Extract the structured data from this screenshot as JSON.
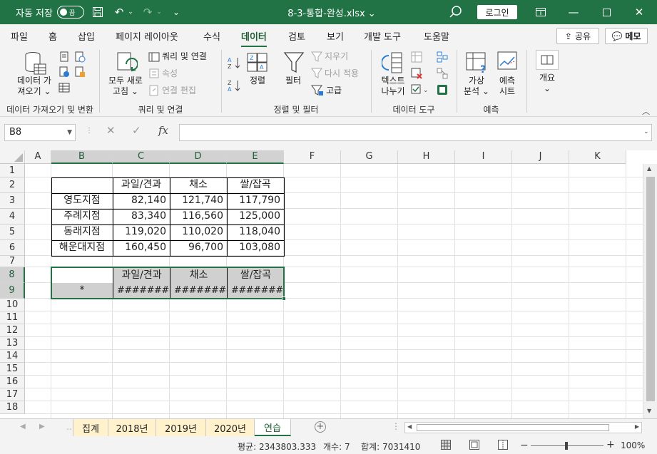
{
  "titlebar": {
    "autosave_label": "자동 저장",
    "autosave_state": "끔",
    "filename": "8-3-통합-완성.xlsx",
    "login": "로그인",
    "bg_color": "#217346"
  },
  "menu": {
    "tabs": [
      "파일",
      "홈",
      "삽입",
      "페이지 레이아웃",
      "수식",
      "데이터",
      "검토",
      "보기",
      "개발 도구",
      "도움말"
    ],
    "active": "데이터",
    "share": "공유",
    "memo": "메모"
  },
  "ribbon": {
    "groups": {
      "get_data": "데이터 가져오기 및 변환",
      "queries": "쿼리 및 연결",
      "sort_filter": "정렬 및 필터",
      "data_tools": "데이터 도구",
      "forecast": "예측"
    },
    "buttons": {
      "get_data_1": "데이터 가",
      "get_data_2": "져오기",
      "refresh_1": "모두 새로",
      "refresh_2": "고침",
      "queries_connections": "쿼리 및 연결",
      "properties": "속성",
      "edit_links": "연결 편집",
      "sort": "정렬",
      "filter": "필터",
      "clear": "지우기",
      "reapply": "다시 적용",
      "advanced": "고급",
      "text_to_columns_1": "텍스트",
      "text_to_columns_2": "나누기",
      "whatif_1": "가상",
      "whatif_2": "분석",
      "forecast_sheet_1": "예측",
      "forecast_sheet_2": "시트",
      "outline": "개요"
    }
  },
  "formula_bar": {
    "name_box": "B8",
    "formula": ""
  },
  "sheet": {
    "columns": [
      "A",
      "B",
      "C",
      "D",
      "E",
      "F",
      "G",
      "H",
      "I",
      "J",
      "K"
    ],
    "rows": [
      "1",
      "2",
      "3",
      "4",
      "5",
      "6",
      "7",
      "8",
      "9",
      "10",
      "11",
      "12",
      "13",
      "14",
      "15",
      "16",
      "17",
      "18"
    ],
    "table1": {
      "headers": [
        "과일/견과",
        "채소",
        "쌀/잡곡"
      ],
      "rows": [
        {
          "label": "영도지점",
          "values": [
            "82,140",
            "121,740",
            "117,790"
          ]
        },
        {
          "label": "주례지점",
          "values": [
            "83,340",
            "116,560",
            "125,000"
          ]
        },
        {
          "label": "동래지점",
          "values": [
            "119,020",
            "110,020",
            "118,040"
          ]
        },
        {
          "label": "해운대지점",
          "values": [
            "160,450",
            "96,700",
            "103,080"
          ]
        }
      ]
    },
    "table2": {
      "headers": [
        "과일/견과",
        "채소",
        "쌀/잡곡"
      ],
      "row_label": "*",
      "values": [
        "########",
        "########",
        "########"
      ]
    }
  },
  "sheet_tabs": {
    "tabs": [
      "집계",
      "2018년",
      "2019년",
      "2020년",
      "연습"
    ],
    "active": "연습"
  },
  "status": {
    "average": "평균: 2343803.333",
    "count": "개수: 7",
    "sum": "합계: 7031410",
    "zoom": "100%"
  }
}
